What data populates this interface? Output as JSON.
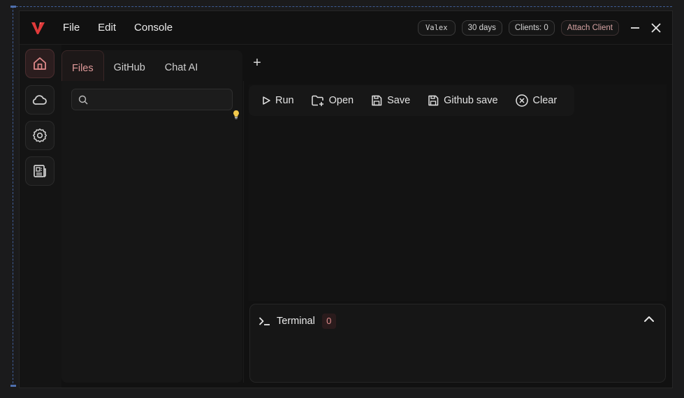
{
  "menu": {
    "items": [
      "File",
      "Edit",
      "Console"
    ]
  },
  "status": {
    "user": "Valex",
    "license": "30 days",
    "clients": "Clients: 0",
    "attach": "Attach Client"
  },
  "tabs": [
    "Files",
    "GitHub",
    "Chat AI"
  ],
  "tab_add": "+",
  "search": {
    "placeholder": "",
    "value": ""
  },
  "toolbar": {
    "run": "Run",
    "open": "Open",
    "save": "Save",
    "github_save": "Github save",
    "clear": "Clear"
  },
  "terminal": {
    "title": "Terminal",
    "count": "0"
  },
  "colors": {
    "accent": "#e03a3a",
    "tab_active": "#e09a9a",
    "bulb": "#f2c94c"
  }
}
